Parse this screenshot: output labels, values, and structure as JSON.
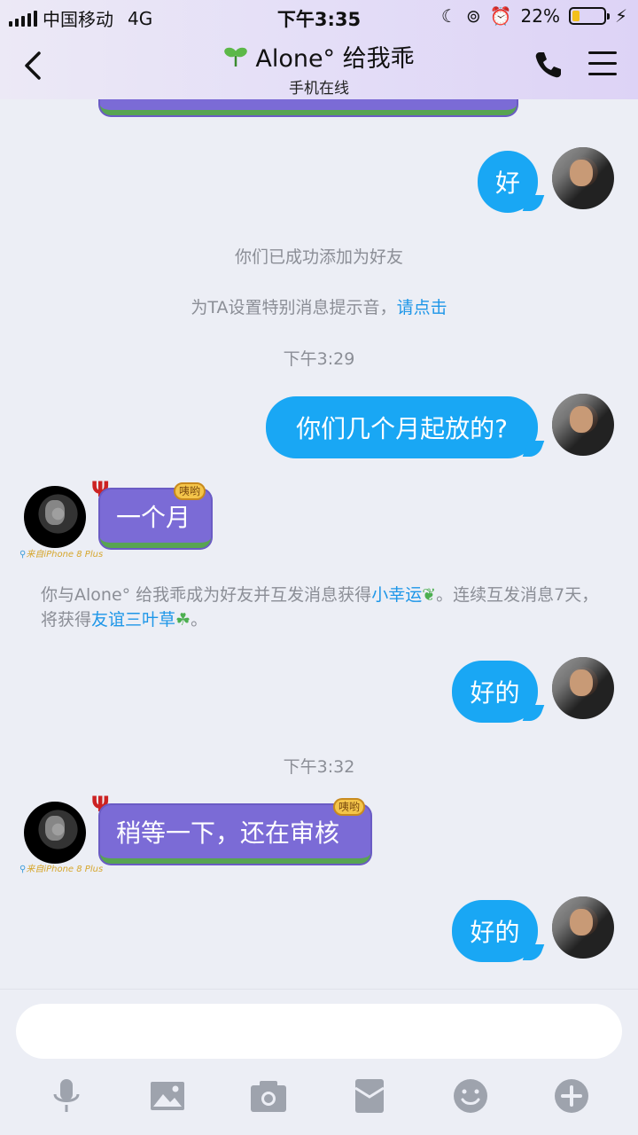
{
  "status": {
    "carrier": "中国移动",
    "network": "4G",
    "time": "下午3:35",
    "battery": "22%",
    "battery_color": "#f3c01b"
  },
  "header": {
    "title": "Alone° 给我乖",
    "subtitle": "手机在线",
    "title_icon": "sprout-icon",
    "back_icon": "chevron-left-icon",
    "call_icon": "phone-icon",
    "menu_icon": "menu-icon"
  },
  "messages": {
    "m1": "好",
    "sys_added": "你们已成功添加为好友",
    "sys_ringtone": "为TA设置特别消息提示音，",
    "sys_ringtone_link": "请点击",
    "time1": "下午3:29",
    "m2": "你们几个月起放的?",
    "m3": "一个月",
    "notice_prefix": "你与Alone° 给我乖成为好友并互发消息获得",
    "notice_link1": "小幸运",
    "notice_mid": "。连续互发消息7天，将获得",
    "notice_link2": "友谊三叶草",
    "notice_suffix": "。",
    "m4": "好的",
    "time2": "下午3:32",
    "m5": "稍等一下，还在审核",
    "m6": "好的",
    "from_device": "来自iPhone 8 Plus",
    "sticker_text": "咦哟"
  },
  "colors": {
    "my_bubble": "#19a7f4",
    "their_bubble": "#7b6bd6",
    "link": "#1d96e8"
  },
  "toolbar": {
    "icons": [
      "microphone-icon",
      "image-icon",
      "camera-icon",
      "red-packet-icon",
      "emoji-icon",
      "plus-icon"
    ]
  }
}
